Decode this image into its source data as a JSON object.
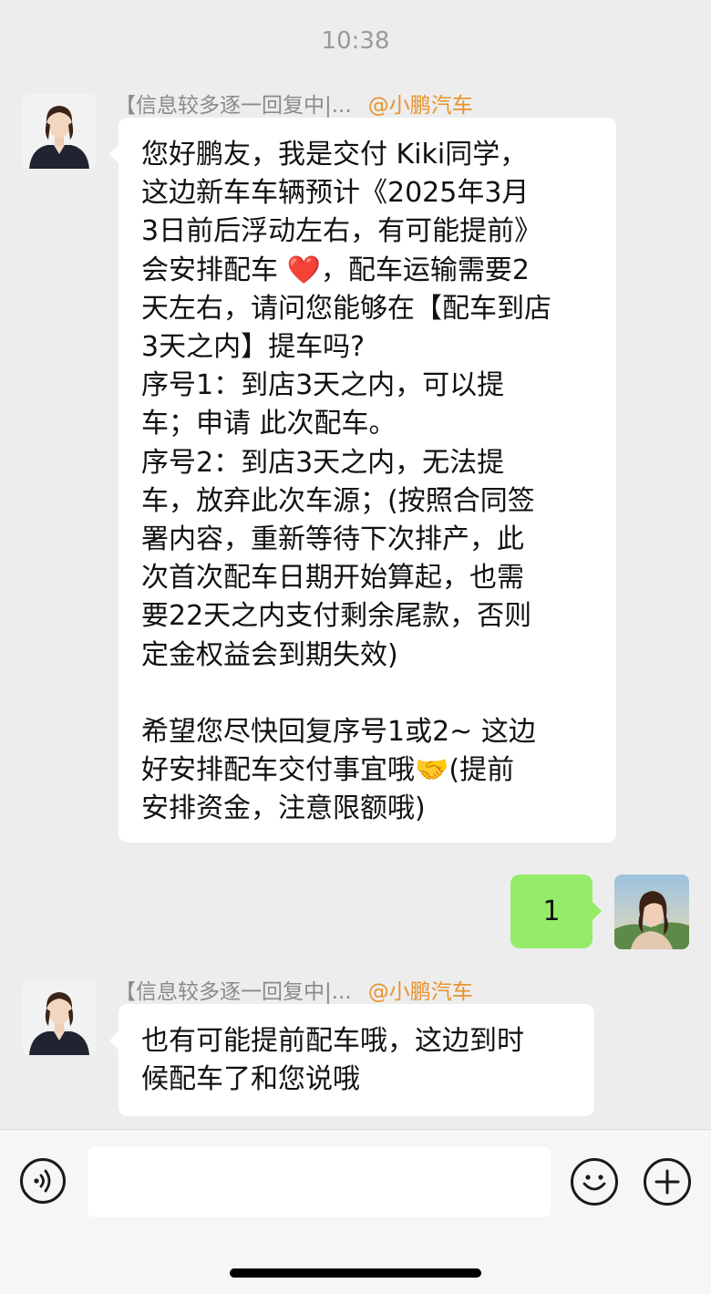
{
  "status": {
    "time": "10:38"
  },
  "chat": {
    "msg1": {
      "sender_name": "【信息较多逐一回复中|...",
      "sender_tag": "@小鹏汽车",
      "lines": [
        "您好鹏友，我是交付 Kiki同学，",
        "这边新车车辆预计《2025年3月",
        "3日前后浮动左右，有可能提前》",
        "会安排配车",
        "，配车运输需要2",
        "天左右，请问您能够在【配车到店",
        "3天之内】提车吗?",
        "序号1：到店3天之内，可以提",
        "车；申请 此次配车。",
        "序号2：到店3天之内，无法提",
        "车，放弃此次车源；(按照合同签",
        "署内容，重新等待下次排产，此",
        "次首次配车日期开始算起，也需",
        "要22天之内支付剩余尾款，否则",
        "定金权益会到期失效)",
        "",
        "希望您尽快回复序号1或2~ 这边",
        "好安排配车交付事宜哦",
        "(提前",
        "安排资金，注意限额哦)"
      ],
      "emoji_heart": "❤️",
      "emoji_handshake": "🤝"
    },
    "msg2": {
      "text": "1"
    },
    "msg3": {
      "sender_name": "【信息较多逐一回复中|...",
      "sender_tag": "@小鹏汽车",
      "lines": [
        "也有可能提前配车哦，这边到时",
        "候配车了和您说哦"
      ]
    }
  },
  "input_bar": {
    "voice_icon": "voice-icon",
    "emoji_icon": "emoji-icon",
    "plus_icon": "plus-icon"
  },
  "colors": {
    "background": "#ededed",
    "incoming_bubble": "#ffffff",
    "outgoing_bubble": "#95ec69",
    "brand_tag": "#e8922c"
  }
}
